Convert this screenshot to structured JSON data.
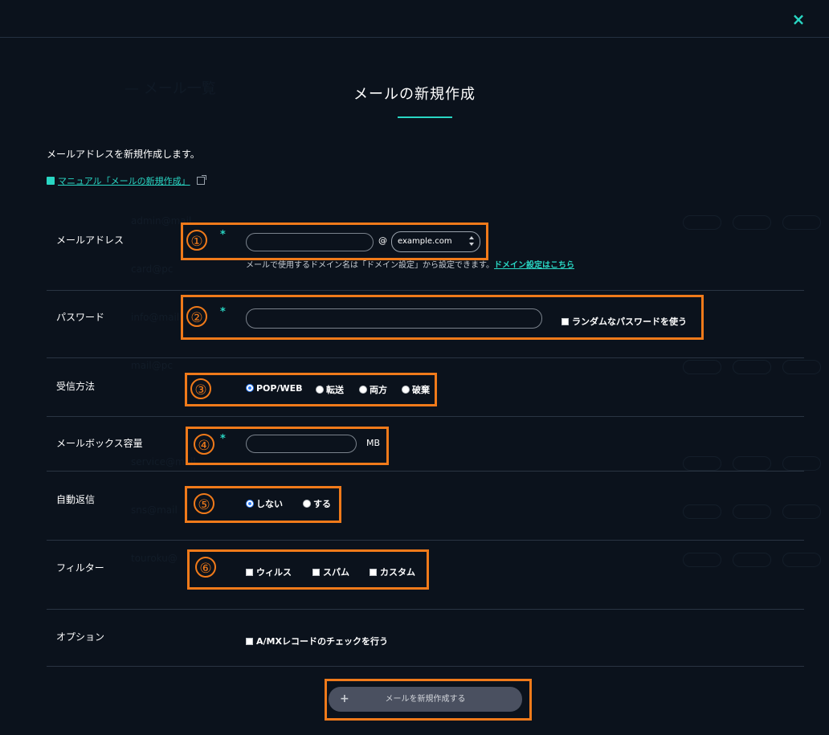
{
  "modal": {
    "title": "メールの新規作成",
    "intro": "メールアドレスを新規作成します。",
    "manual_link": "マニュアル「メールの新規作成」",
    "close_label": "×"
  },
  "markers": [
    "①",
    "②",
    "③",
    "④",
    "⑤",
    "⑥"
  ],
  "required_mark": "*",
  "email": {
    "label": "メールアドレス",
    "local_value": "",
    "at": "@",
    "domain_selected": "example.com",
    "hint_text": "メールで使用するドメイン名は「ドメイン設定」から設定できます。",
    "hint_link": "ドメイン設定はこちら"
  },
  "password": {
    "label": "パスワード",
    "value": "",
    "random_label": "ランダムなパスワードを使う"
  },
  "receive": {
    "label": "受信方法",
    "options": [
      "POP/WEB",
      "転送",
      "両方",
      "破棄"
    ],
    "selected": "POP/WEB"
  },
  "mailbox": {
    "label": "メールボックス容量",
    "value": "",
    "unit": "MB"
  },
  "autoreply": {
    "label": "自動返信",
    "options": [
      "しない",
      "する"
    ],
    "selected": "しない"
  },
  "filter": {
    "label": "フィルター",
    "options": [
      "ウィルス",
      "スパム",
      "カスタム"
    ]
  },
  "option": {
    "label": "オプション",
    "check_label": "A/MXレコードのチェックを行う"
  },
  "submit": {
    "icon": "plus-icon",
    "label": "メールを新規作成する"
  },
  "colors": {
    "background": "#0b121c",
    "accent": "#29d6c3",
    "marker": "#f07a1a",
    "button": "#4a5060"
  }
}
